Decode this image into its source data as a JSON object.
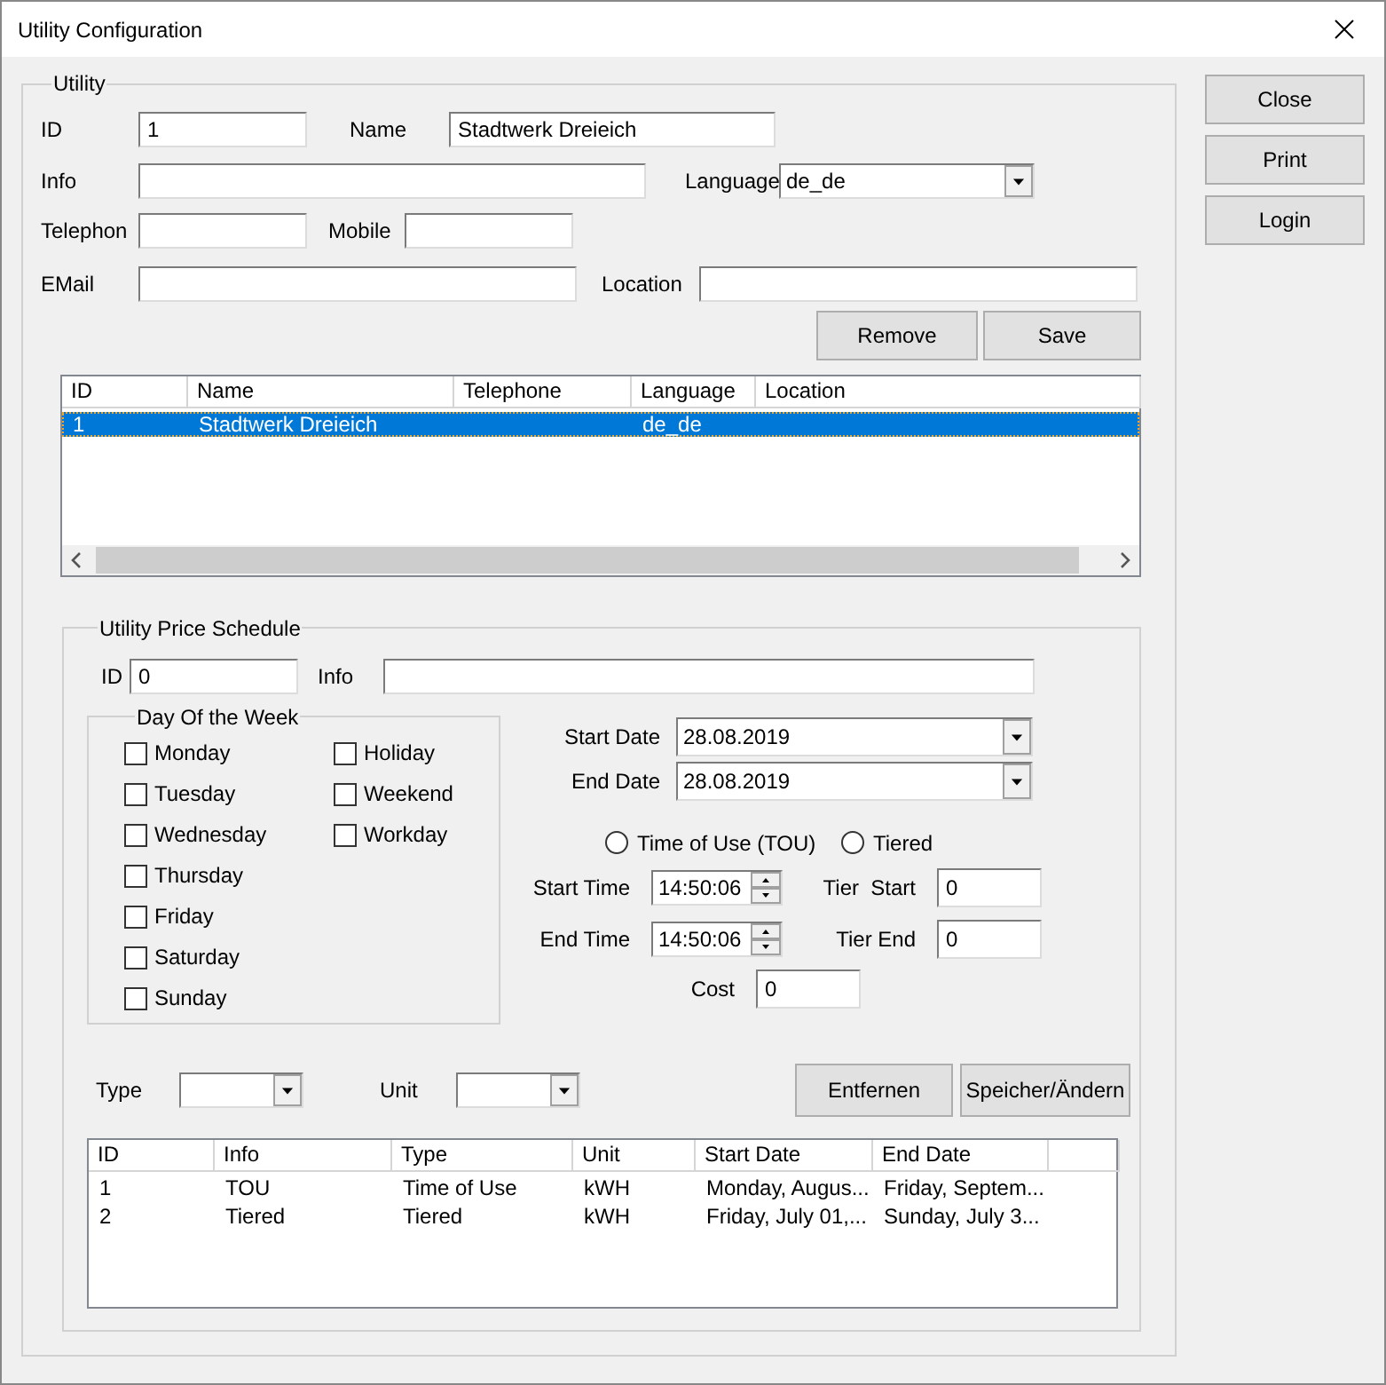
{
  "window": {
    "title": "Utility Configuration"
  },
  "side_buttons": [
    "Close",
    "Print",
    "Login"
  ],
  "utility": {
    "legend": "Utility",
    "id": {
      "label": "ID",
      "value": "1"
    },
    "name": {
      "label": "Name",
      "value": "Stadtwerk Dreieich"
    },
    "info": {
      "label": "Info"
    },
    "language": {
      "label": "Language",
      "value": "de_de"
    },
    "telephone": {
      "label": "Telephon"
    },
    "mobile": {
      "label": "Mobile"
    },
    "email": {
      "label": "EMail"
    },
    "location": {
      "label": "Location"
    },
    "buttons": [
      "Remove",
      "Save"
    ],
    "table": {
      "columns": [
        "ID",
        "Name",
        "Telephone",
        "Language",
        "Location"
      ],
      "rows": [
        {
          "cells": [
            "1",
            "Stadtwerk Dreieich",
            null,
            "de_de",
            null
          ],
          "selected": true
        }
      ]
    }
  },
  "schedule": {
    "legend": "Utility Price Schedule",
    "id": {
      "label": "ID",
      "value": "0"
    },
    "info": {
      "label": "Info"
    },
    "days": {
      "legend": "Day Of the Week",
      "columns": [
        [
          {
            "label": "Monday",
            "checked": false
          },
          {
            "label": "Tuesday",
            "checked": false
          },
          {
            "label": "Wednesday",
            "checked": false
          },
          {
            "label": "Thursday",
            "checked": false
          },
          {
            "label": "Friday",
            "checked": false
          },
          {
            "label": "Saturday",
            "checked": false
          },
          {
            "label": "Sunday",
            "checked": false
          }
        ],
        [
          {
            "label": "Holiday",
            "checked": false
          },
          {
            "label": "Weekend",
            "checked": false
          },
          {
            "label": "Workday",
            "checked": false
          }
        ]
      ]
    },
    "start_date": {
      "label": "Start Date",
      "value": "28.08.2019"
    },
    "end_date": {
      "label": "End Date",
      "value": "28.08.2019"
    },
    "modes": [
      {
        "label": "Time of Use (TOU)",
        "selected": false
      },
      {
        "label": "Tiered",
        "selected": false
      }
    ],
    "start_time": {
      "label": "Start Time",
      "value": "14:50:06"
    },
    "tier_start": {
      "label": "Tier  Start",
      "value": "0"
    },
    "end_time": {
      "label": "End Time",
      "value": "14:50:06"
    },
    "tier_end": {
      "label": "Tier End",
      "value": "0"
    },
    "cost": {
      "label": "Cost",
      "value": "0"
    },
    "type": {
      "label": "Type"
    },
    "unit": {
      "label": "Unit"
    },
    "buttons": [
      "Entfernen",
      "Speicher/Ändern"
    ],
    "table": {
      "columns": [
        "ID",
        "Info",
        "Type",
        "Unit",
        "Start Date",
        "End Date"
      ],
      "rows": [
        {
          "cells": [
            "1",
            "TOU",
            "Time of Use",
            "kWH",
            "Monday, Augus...",
            "Friday, Septem..."
          ],
          "selected": false
        },
        {
          "cells": [
            "2",
            "Tiered",
            "Tiered",
            "kWH",
            "Friday, July 01,...",
            "Sunday, July 3..."
          ],
          "selected": false
        }
      ]
    }
  }
}
